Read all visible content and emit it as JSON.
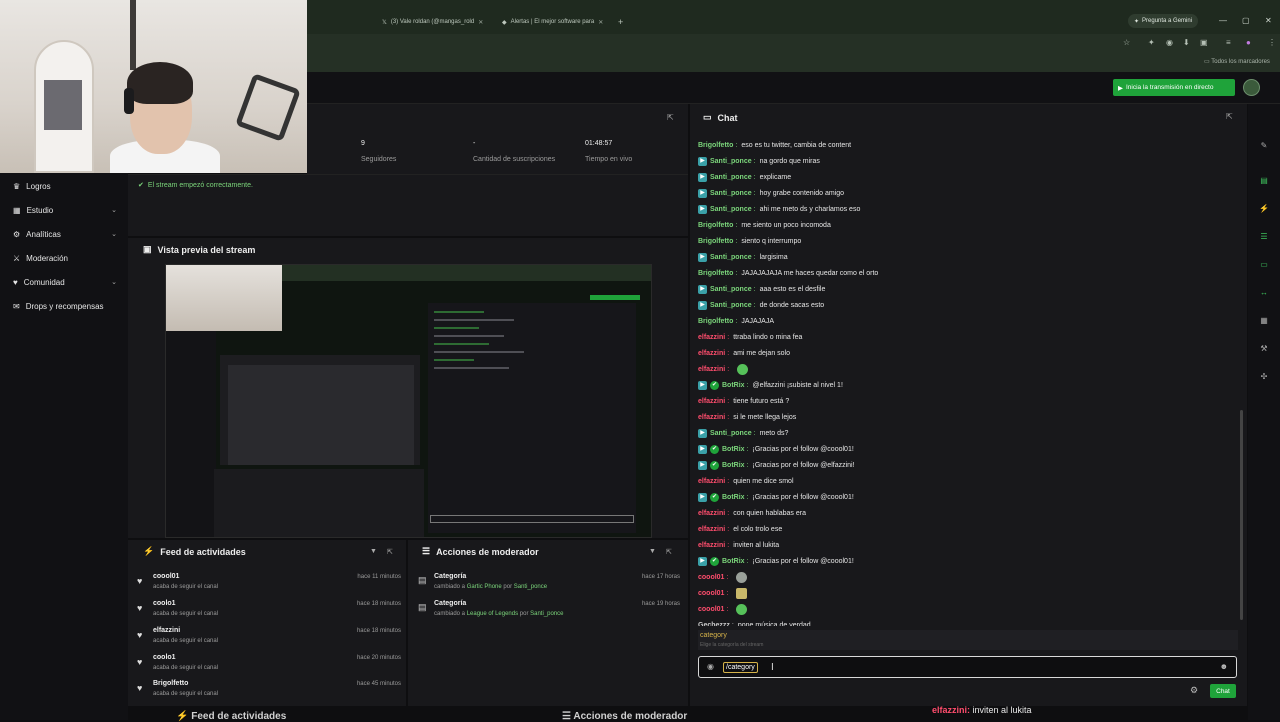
{
  "browser": {
    "tabs": [
      {
        "label": "(3) Vale roldan (@mangas_rold"
      },
      {
        "label": "Alertas | El mejor software para"
      }
    ],
    "gemini_label": "Pregunta a Gemini",
    "bookmarks_label": "Todos los marcadores"
  },
  "topbar": {
    "go_live_label": "Inicia la transmisión en directo"
  },
  "sidebar": {
    "items": [
      {
        "label": "Logros"
      },
      {
        "label": "Estudio"
      },
      {
        "label": "Analíticas"
      },
      {
        "label": "Moderación"
      },
      {
        "label": "Comunidad"
      },
      {
        "label": "Drops y recompensas"
      }
    ]
  },
  "stats": [
    {
      "value": "9",
      "label": "Seguidores"
    },
    {
      "value": "-",
      "label": "Cantidad de suscripciones"
    },
    {
      "value": "01:48:57",
      "label": "Tiempo en vivo"
    }
  ],
  "notice": "El stream empezó correctamente.",
  "preview": {
    "title": "Vista previa del stream"
  },
  "feed": {
    "title": "Feed de actividades",
    "items": [
      {
        "user": "coool01",
        "desc": "acaba de seguir el canal",
        "time": "hace 11 minutos"
      },
      {
        "user": "coolo1",
        "desc": "acaba de seguir el canal",
        "time": "hace 18 minutos"
      },
      {
        "user": "elfazzini",
        "desc": "acaba de seguir el canal",
        "time": "hace 18 minutos"
      },
      {
        "user": "coolo1",
        "desc": "acaba de seguir el canal",
        "time": "hace 20 minutos"
      },
      {
        "user": "Brigolfetto",
        "desc": "acaba de seguir el canal",
        "time": "hace 45 minutos"
      }
    ]
  },
  "mod": {
    "title": "Acciones de moderador",
    "items": [
      {
        "title": "Categoría",
        "prefix": "cambiado a",
        "value": "Gartic Phone",
        "by": "por",
        "user": "Santi_ponce",
        "time": "hace 17 horas"
      },
      {
        "title": "Categoría",
        "prefix": "cambiado a",
        "value": "League of Legends",
        "by": "por",
        "user": "Santi_ponce",
        "time": "hace 19 horas"
      }
    ]
  },
  "chat": {
    "title": "Chat",
    "colors": {
      "Brigolfetto": "#7bd57b",
      "Santi_ponce": "#7bd57b",
      "elfazzini": "#ff4d6d",
      "BotRix": "#7bd57b",
      "coool01": "#ff4d6d",
      "Gechezzz": "#c9c9c9"
    },
    "messages": [
      {
        "user": "Brigolfetto",
        "text": "eso es tu twitter, cambia de content"
      },
      {
        "user": "Santi_ponce",
        "badge": "b",
        "text": "na gordo que miras"
      },
      {
        "user": "Santi_ponce",
        "badge": "b",
        "text": "explicame"
      },
      {
        "user": "Santi_ponce",
        "badge": "b",
        "text": "hoy grabe contenido amigo"
      },
      {
        "user": "Santi_ponce",
        "badge": "b",
        "text": "ahi me meto ds y charlamos eso"
      },
      {
        "user": "Brigolfetto",
        "text": "me siento un poco incomoda"
      },
      {
        "user": "Brigolfetto",
        "text": "siento q interrumpo"
      },
      {
        "user": "Santi_ponce",
        "badge": "b",
        "text": "largisima"
      },
      {
        "user": "Brigolfetto",
        "text": "JAJAJAJAJA me haces quedar como el orto"
      },
      {
        "user": "Santi_ponce",
        "badge": "b",
        "text": "aaa esto es el desfile"
      },
      {
        "user": "Santi_ponce",
        "badge": "b",
        "text": "de donde sacas esto"
      },
      {
        "user": "Brigolfetto",
        "text": "JAJAJAJA"
      },
      {
        "user": "elfazzini",
        "text": "ttraba lindo o mina fea"
      },
      {
        "user": "elfazzini",
        "text": "ami me dejan solo"
      },
      {
        "user": "elfazzini",
        "text": "",
        "emote": "green"
      },
      {
        "user": "BotRix",
        "badge": "bv",
        "text": "@elfazzini ¡subiste al nivel 1!"
      },
      {
        "user": "elfazzini",
        "text": "tiene futuro está ?"
      },
      {
        "user": "elfazzini",
        "text": "si le mete llega lejos"
      },
      {
        "user": "Santi_ponce",
        "badge": "b",
        "text": "meto ds?"
      },
      {
        "user": "BotRix",
        "badge": "bv",
        "text": "¡Gracias por el follow @coool01!"
      },
      {
        "user": "BotRix",
        "badge": "bv",
        "text": "¡Gracias por el follow @elfazzini!"
      },
      {
        "user": "elfazzini",
        "text": "quien me dice smol"
      },
      {
        "user": "BotRix",
        "badge": "bv",
        "text": "¡Gracias por el follow @coool01!"
      },
      {
        "user": "elfazzini",
        "text": "con quien hablabas era"
      },
      {
        "user": "elfazzini",
        "text": "el colo trolo ese"
      },
      {
        "user": "elfazzini",
        "text": "inviten al lukita"
      },
      {
        "user": "BotRix",
        "badge": "bv",
        "text": "¡Gracias por el follow @coool01!"
      },
      {
        "user": "coool01",
        "text": "",
        "emote": "gray"
      },
      {
        "user": "coool01",
        "text": "",
        "emote": "yellow"
      },
      {
        "user": "coool01",
        "text": "",
        "emote": "green"
      },
      {
        "user": "Gechezzz",
        "text": "pone música de verdad"
      }
    ],
    "suggestion_cmd": "category",
    "suggestion_desc": "Elige la categoría del stream",
    "input_value": "/category",
    "send_label": "Chat"
  },
  "echo": {
    "feed_title": "Feed de actividades",
    "mod_title": "Acciones de moderador",
    "chat_user": "elfazzini:",
    "chat_text": " inviten al lukita"
  },
  "accent_color": "#1fa33a"
}
